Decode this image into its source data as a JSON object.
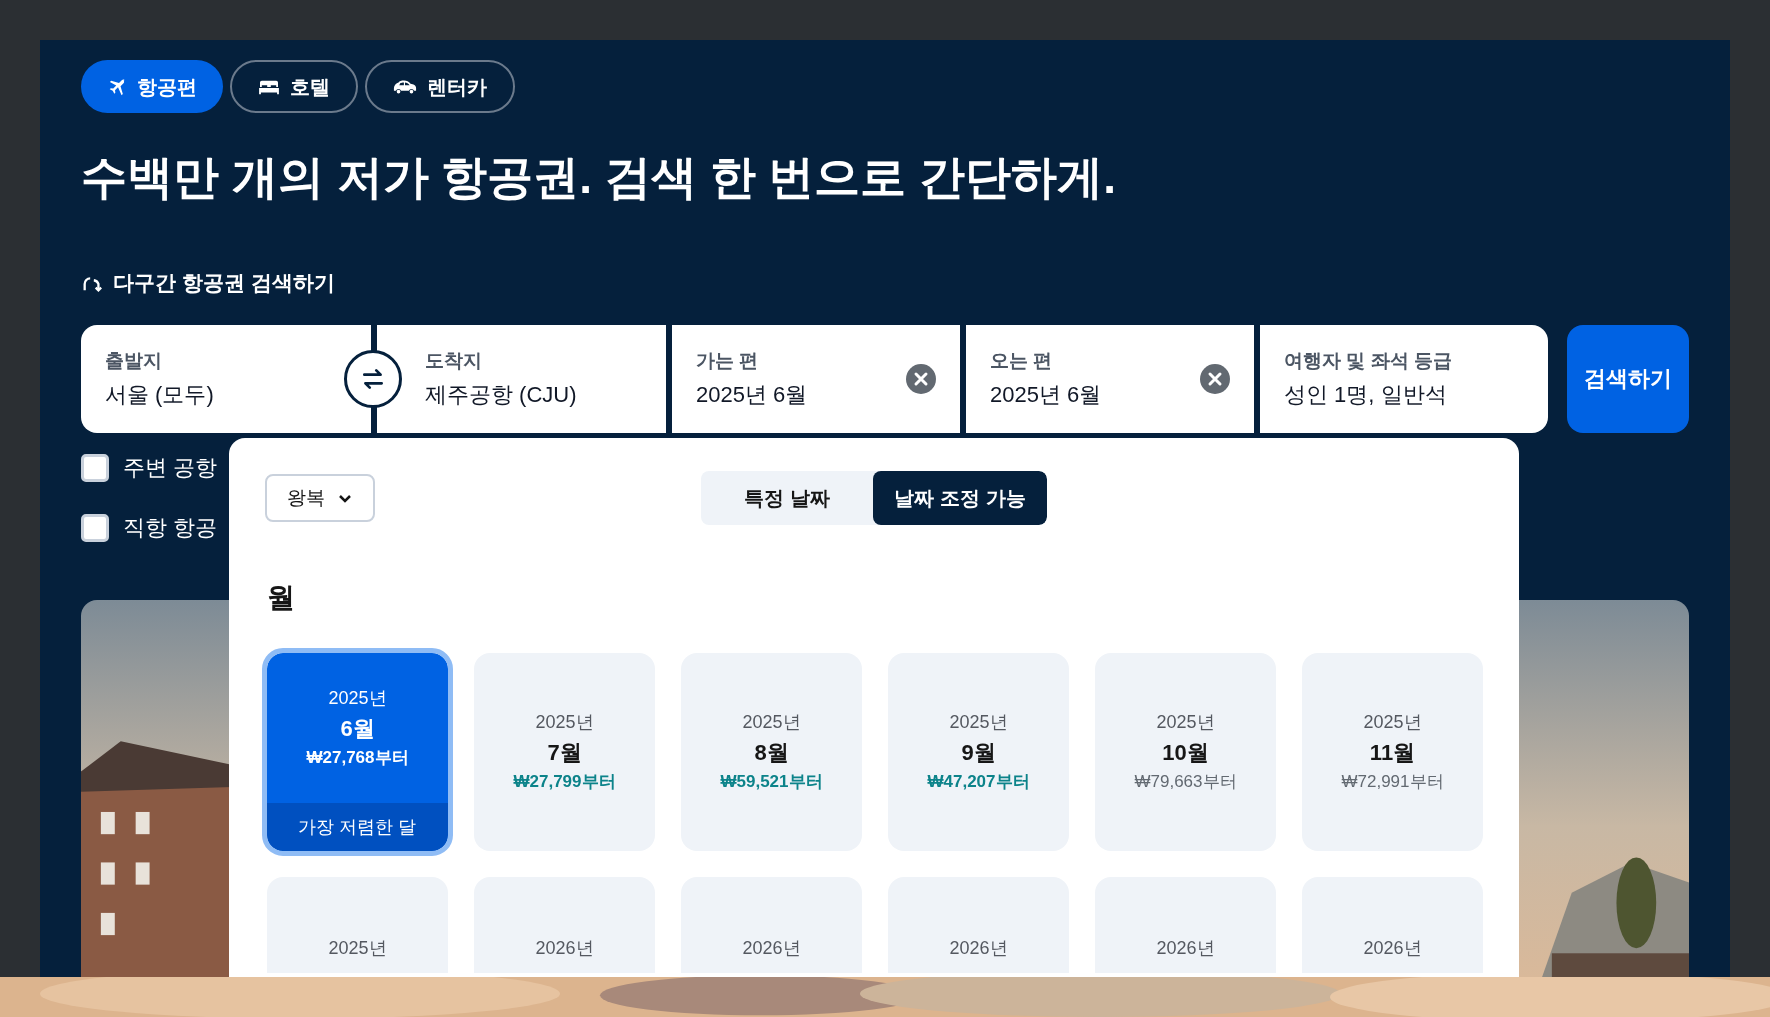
{
  "tabs": [
    {
      "label": "항공편",
      "kind": "plane",
      "selected": true
    },
    {
      "label": "호텔",
      "kind": "bed",
      "selected": false
    },
    {
      "label": "렌터카",
      "kind": "car",
      "selected": false
    }
  ],
  "headline": "수백만 개의 저가 항공권. 검색 한 번으로 간단하게.",
  "multi_city": "다구간 항공권 검색하기",
  "fields": [
    {
      "label": "출발지",
      "value": "서울 (모두)",
      "clearable": false
    },
    {
      "label": "도착지",
      "value": "제주공항 (CJU)",
      "clearable": false
    },
    {
      "label": "가는 편",
      "value": "2025년 6월",
      "clearable": true
    },
    {
      "label": "오는 편",
      "value": "2025년 6월",
      "clearable": true
    },
    {
      "label": "여행자 및 좌석 등급",
      "value": "성인 1명, 일반석",
      "clearable": false
    }
  ],
  "search_button": "검색하기",
  "checkboxes": [
    {
      "label": "주변 공항",
      "checked": false
    },
    {
      "label": "직항 항공",
      "checked": false
    }
  ],
  "popup": {
    "trip_type": "왕복",
    "modes": [
      {
        "label": "특정 날짜",
        "selected": false
      },
      {
        "label": "날짜 조정 가능",
        "selected": true
      }
    ],
    "section_title": "월",
    "months": [
      {
        "year": "2025년",
        "month": "6월",
        "price": "₩27,768부터",
        "selected": true,
        "badge": "가장 저렴한 달"
      },
      {
        "year": "2025년",
        "month": "7월",
        "price": "₩27,799부터",
        "kind": "cheap",
        "selected": false
      },
      {
        "year": "2025년",
        "month": "8월",
        "price": "₩59,521부터",
        "kind": "cheap",
        "selected": false
      },
      {
        "year": "2025년",
        "month": "9월",
        "price": "₩47,207부터",
        "kind": "cheap",
        "selected": false
      },
      {
        "year": "2025년",
        "month": "10월",
        "price": "₩79,663부터",
        "kind": "normal",
        "selected": false
      },
      {
        "year": "2025년",
        "month": "11월",
        "price": "₩72,991부터",
        "kind": "normal",
        "selected": false
      },
      {
        "year": "2025년",
        "selected": false
      },
      {
        "year": "2026년",
        "selected": false
      },
      {
        "year": "2026년",
        "selected": false
      },
      {
        "year": "2026년",
        "selected": false
      },
      {
        "year": "2026년",
        "selected": false
      },
      {
        "year": "2026년",
        "selected": false
      }
    ]
  }
}
